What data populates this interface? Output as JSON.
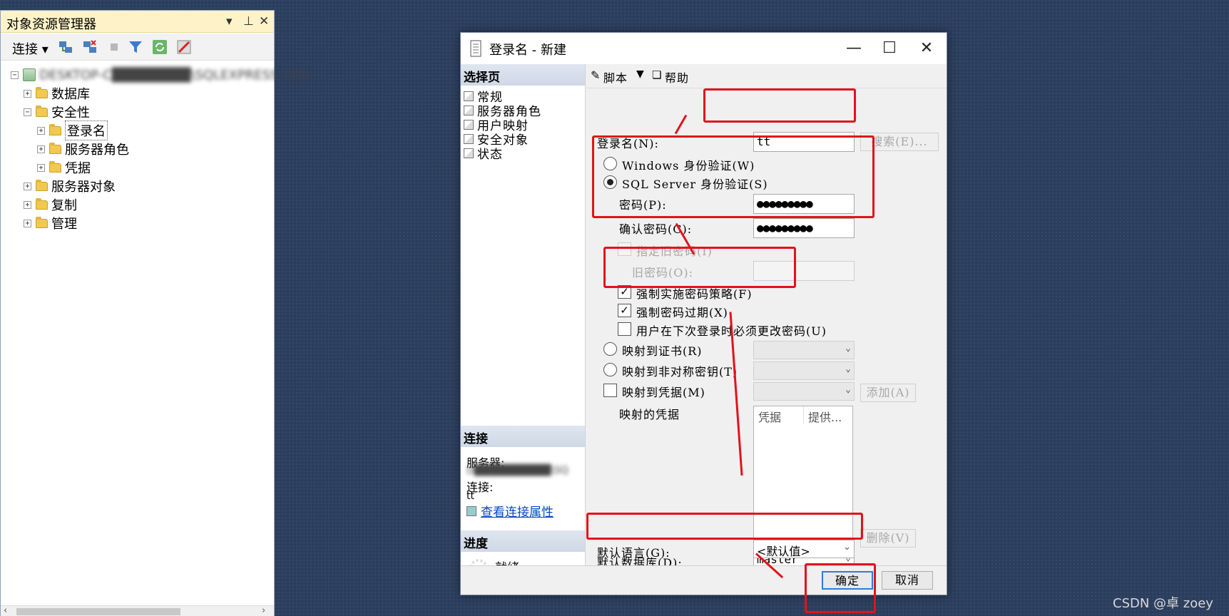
{
  "object_explorer": {
    "title": "对象资源管理器",
    "pin_glyph": "▾ ⊥ ✕",
    "toolbar": {
      "connect_label": "连接 ▾"
    },
    "server_node_text": "DESKTOP-C████████\\SQLEXPRESS (SQL",
    "tree": [
      {
        "label": "数据库"
      },
      {
        "label": "安全性"
      },
      {
        "label": "登录名"
      },
      {
        "label": "服务器角色"
      },
      {
        "label": "凭据"
      },
      {
        "label": "服务器对象"
      },
      {
        "label": "复制"
      },
      {
        "label": "管理"
      }
    ]
  },
  "dialog": {
    "title": "登录名 - 新建",
    "select_page_header": "选择页",
    "pages": [
      "常规",
      "服务器角色",
      "用户映射",
      "安全对象",
      "状态"
    ],
    "connection_header": "连接",
    "server_label": "服务器:",
    "server_value": "D██████████\\SQ",
    "connection_label": "连接:",
    "connection_value": "tt",
    "view_conn_props": "查看连接属性",
    "progress_header": "进度",
    "progress_status": "就绪",
    "script_label": "脚本",
    "help_label": "帮助",
    "login_name_label": "登录名(N):",
    "login_name_value": "tt",
    "search_button": "搜索(E)...",
    "windows_auth": "Windows 身份验证(W)",
    "sql_auth": "SQL Server 身份验证(S)",
    "password_label": "密码(P):",
    "password_value": "●●●●●●●●●",
    "confirm_password_label": "确认密码(C):",
    "confirm_password_value": "●●●●●●●●●",
    "specify_old_password": "指定旧密码(I)",
    "old_password_label": "旧密码(O):",
    "enforce_policy": "强制实施密码策略(F)",
    "enforce_expiration": "强制密码过期(X)",
    "must_change": "用户在下次登录时必须更改密码(U)",
    "map_certificate": "映射到证书(R)",
    "map_asym_key": "映射到非对称密钥(T)",
    "map_credential": "映射到凭据(M)",
    "add_button": "添加(A)",
    "mapped_credentials": "映射的凭据",
    "cred_col_1": "凭据",
    "cred_col_2": "提供...",
    "delete_button": "删除(V)",
    "default_db_label": "默认数据库(D):",
    "default_db_value": "master",
    "default_lang_label": "默认语言(G):",
    "default_lang_value": "<默认值>",
    "ok_button": "确定",
    "cancel_button": "取消"
  },
  "watermark": "CSDN @卓  zoey",
  "colors": {
    "annotation_red": "#e3121b",
    "desktop_bg": "#2b3e5e",
    "title_highlight": "#fef3c8"
  }
}
